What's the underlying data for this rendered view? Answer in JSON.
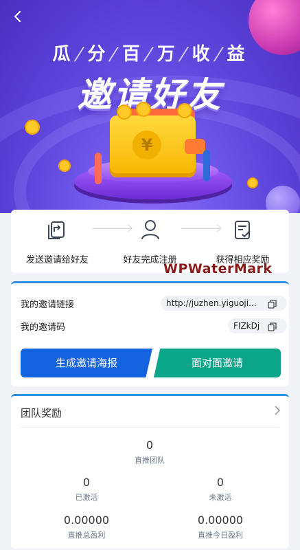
{
  "header": {
    "slogan": [
      "瓜",
      "分",
      "百",
      "万",
      "收",
      "益"
    ],
    "headline": "邀请好友",
    "wallet_symbol": "¥"
  },
  "steps": [
    {
      "label": "发送邀请给好友",
      "icon": "share-document-icon"
    },
    {
      "label": "好友完成注册",
      "icon": "user-icon"
    },
    {
      "label": "获得相应奖励",
      "icon": "reward-check-icon"
    }
  ],
  "watermark": "WPWaterMark",
  "invite": {
    "link_label": "我的邀请链接",
    "link_value": "http://juzhen.yiguoji...",
    "code_label": "我的邀请码",
    "code_value": "FIZkDj",
    "poster_button": "生成邀请海报",
    "face_button": "面对面邀请"
  },
  "team": {
    "title": "团队奖励",
    "direct_team": {
      "value": "0",
      "caption": "直推团队"
    },
    "activated": {
      "value": "0",
      "caption": "已激活"
    },
    "not_activated": {
      "value": "0",
      "caption": "未激活"
    },
    "direct_total_profit": {
      "value": "0.00000",
      "caption": "直推总盈利"
    },
    "direct_today_profit": {
      "value": "0.00000",
      "caption": "直推今日盈利"
    }
  },
  "colors": {
    "accent_blue": "#1663e0",
    "accent_green": "#0ba58a",
    "card_border": "#2f8fe6",
    "hero_purple": "#6e57ea"
  }
}
